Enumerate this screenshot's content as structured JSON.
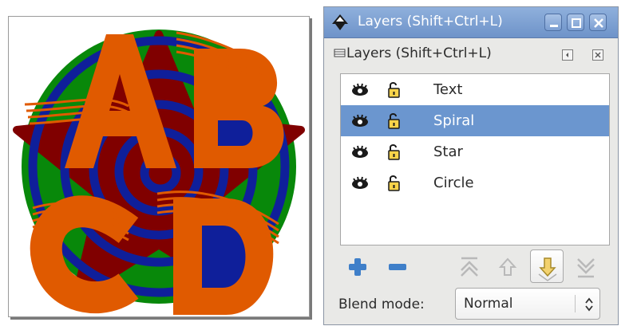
{
  "canvas": {
    "colors": {
      "circle": "#08880a",
      "star": "#800000",
      "spiral": "#0f1f9a",
      "text": "#e05a00"
    }
  },
  "dialog": {
    "title": "Layers (Shift+Ctrl+L)",
    "tab_label": "Layers (Shift+Ctrl+L)",
    "window_buttons": [
      "minimize-icon",
      "maximize-icon",
      "close-icon"
    ],
    "tab_buttons": [
      "menu-icon",
      "close-icon"
    ],
    "selection_color": "#6b96cf",
    "layers": [
      {
        "name": "Text",
        "visible": true,
        "locked": false,
        "selected": false
      },
      {
        "name": "Spiral",
        "visible": true,
        "locked": false,
        "selected": true
      },
      {
        "name": "Star",
        "visible": true,
        "locked": false,
        "selected": false
      },
      {
        "name": "Circle",
        "visible": true,
        "locked": false,
        "selected": false
      }
    ],
    "toolbar": {
      "add_icon": "plus-icon",
      "remove_icon": "minus-icon",
      "raise_to_top_icon": "raise-to-top-icon",
      "raise_icon": "raise-icon",
      "lower_icon": "lower-icon",
      "lower_to_bottom_icon": "lower-to-bottom-icon"
    },
    "blend": {
      "label": "Blend mode:",
      "value": "Normal"
    }
  }
}
